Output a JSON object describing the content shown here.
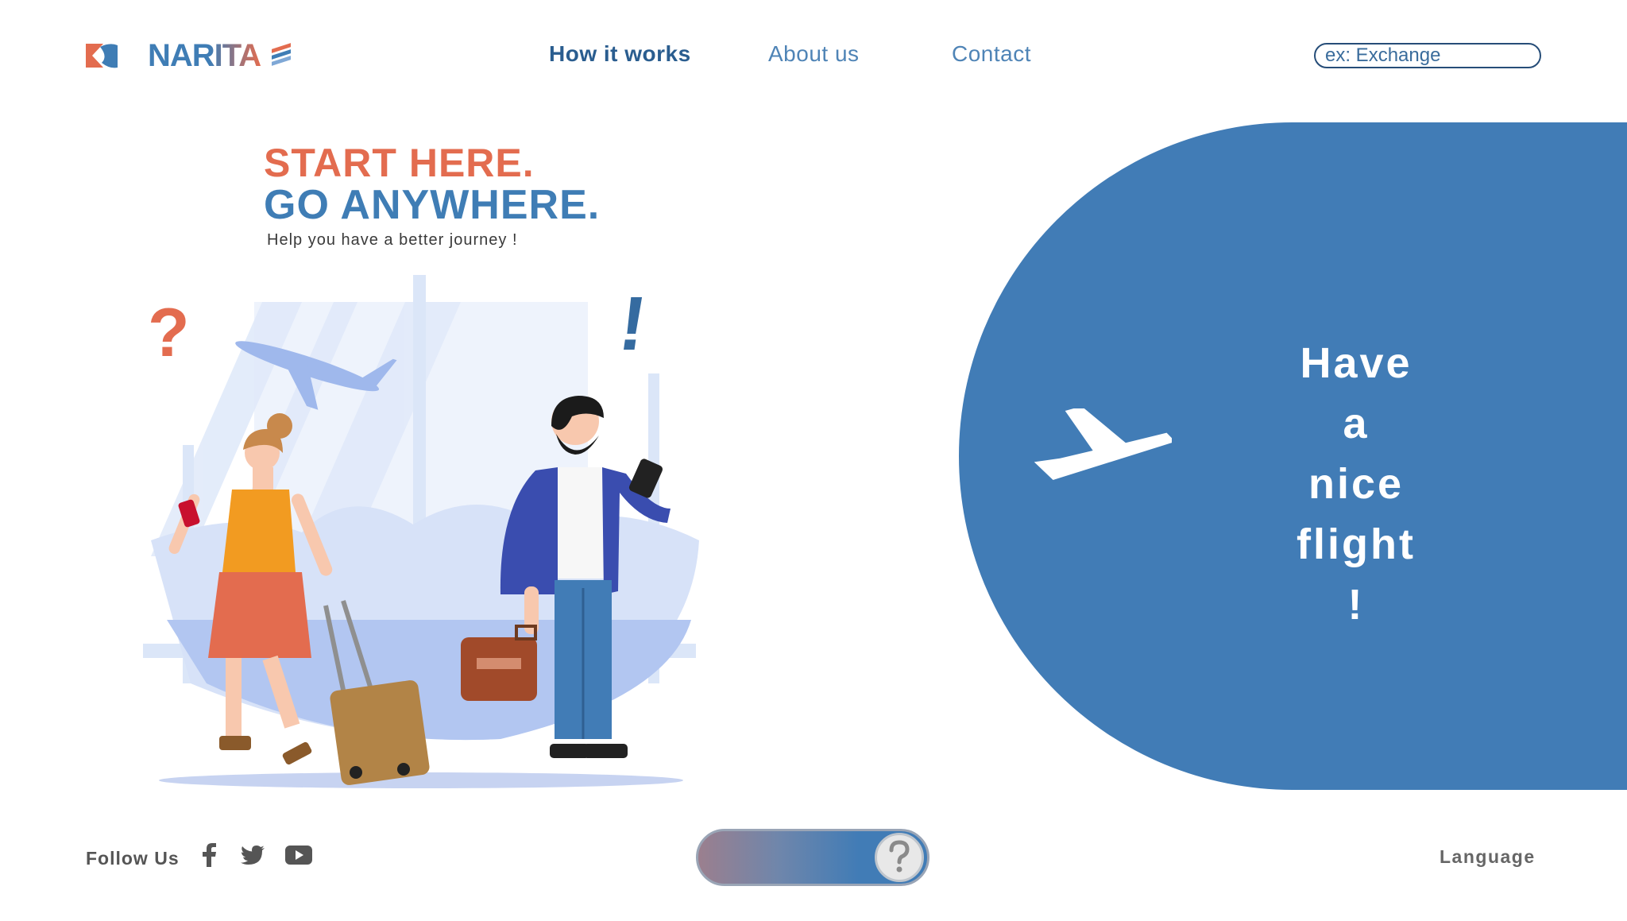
{
  "header": {
    "brand": "NARITA",
    "nav": [
      {
        "label": "How it works",
        "active": true
      },
      {
        "label": "About us",
        "active": false
      },
      {
        "label": "Contact",
        "active": false
      }
    ],
    "search": {
      "placeholder": "ex: Exchange",
      "value": ""
    }
  },
  "hero": {
    "line1": "START HERE.",
    "line2": "GO ANYWHERE.",
    "subtitle": "Help you have a better journey !"
  },
  "panel": {
    "lines": [
      "Have",
      "a",
      "nice",
      "flight !"
    ],
    "icon": "departure-plane-icon"
  },
  "footer": {
    "follow_label": "Follow Us",
    "social": [
      "facebook-icon",
      "twitter-icon",
      "youtube-icon"
    ],
    "help_icon": "question-mark-icon",
    "language_label": "Language"
  },
  "colors": {
    "brand_blue": "#417cb6",
    "brand_orange": "#e36c4f",
    "nav_active": "#2a5d8f",
    "nav_idle": "#4f84b6"
  }
}
